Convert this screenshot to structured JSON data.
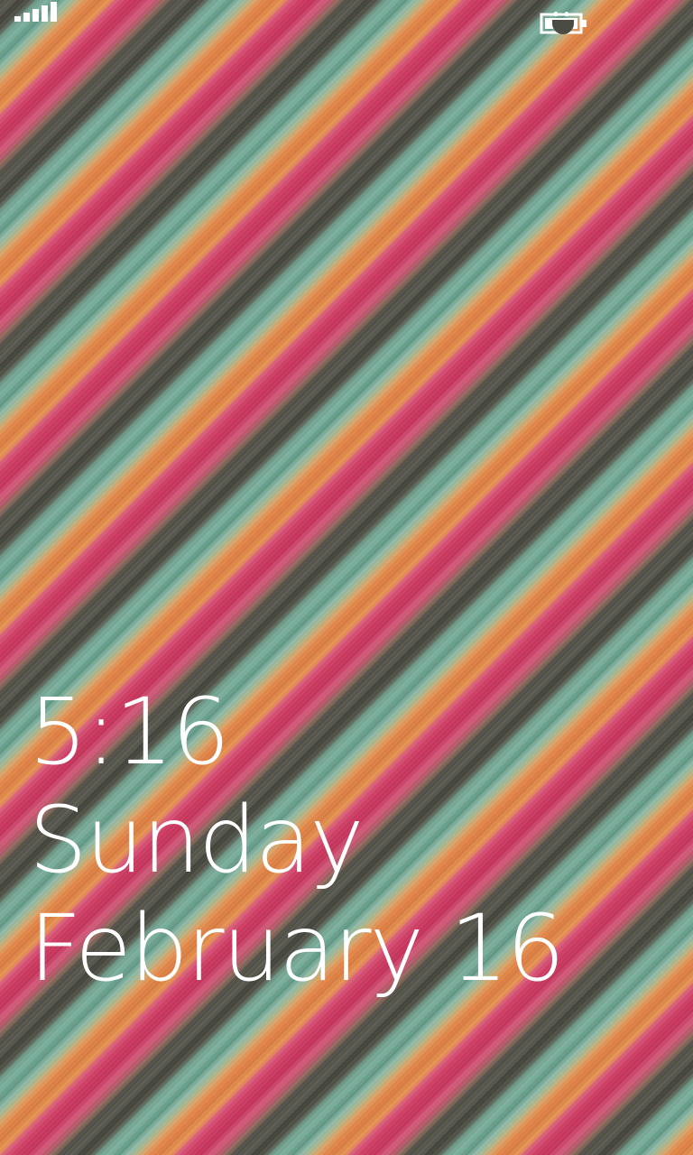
{
  "lock_screen": {
    "time": "5:16",
    "day": "Sunday",
    "date": "February 16"
  },
  "status_bar": {
    "signal_icon": "signal-strength-icon",
    "battery_icon": "battery-charging-icon"
  },
  "colors": {
    "text": "#ffffff",
    "stripe_red": "#cc3b62",
    "stripe_orange": "#e2874a",
    "stripe_teal": "#7cb09d",
    "stripe_gray": "#4d4d44"
  }
}
